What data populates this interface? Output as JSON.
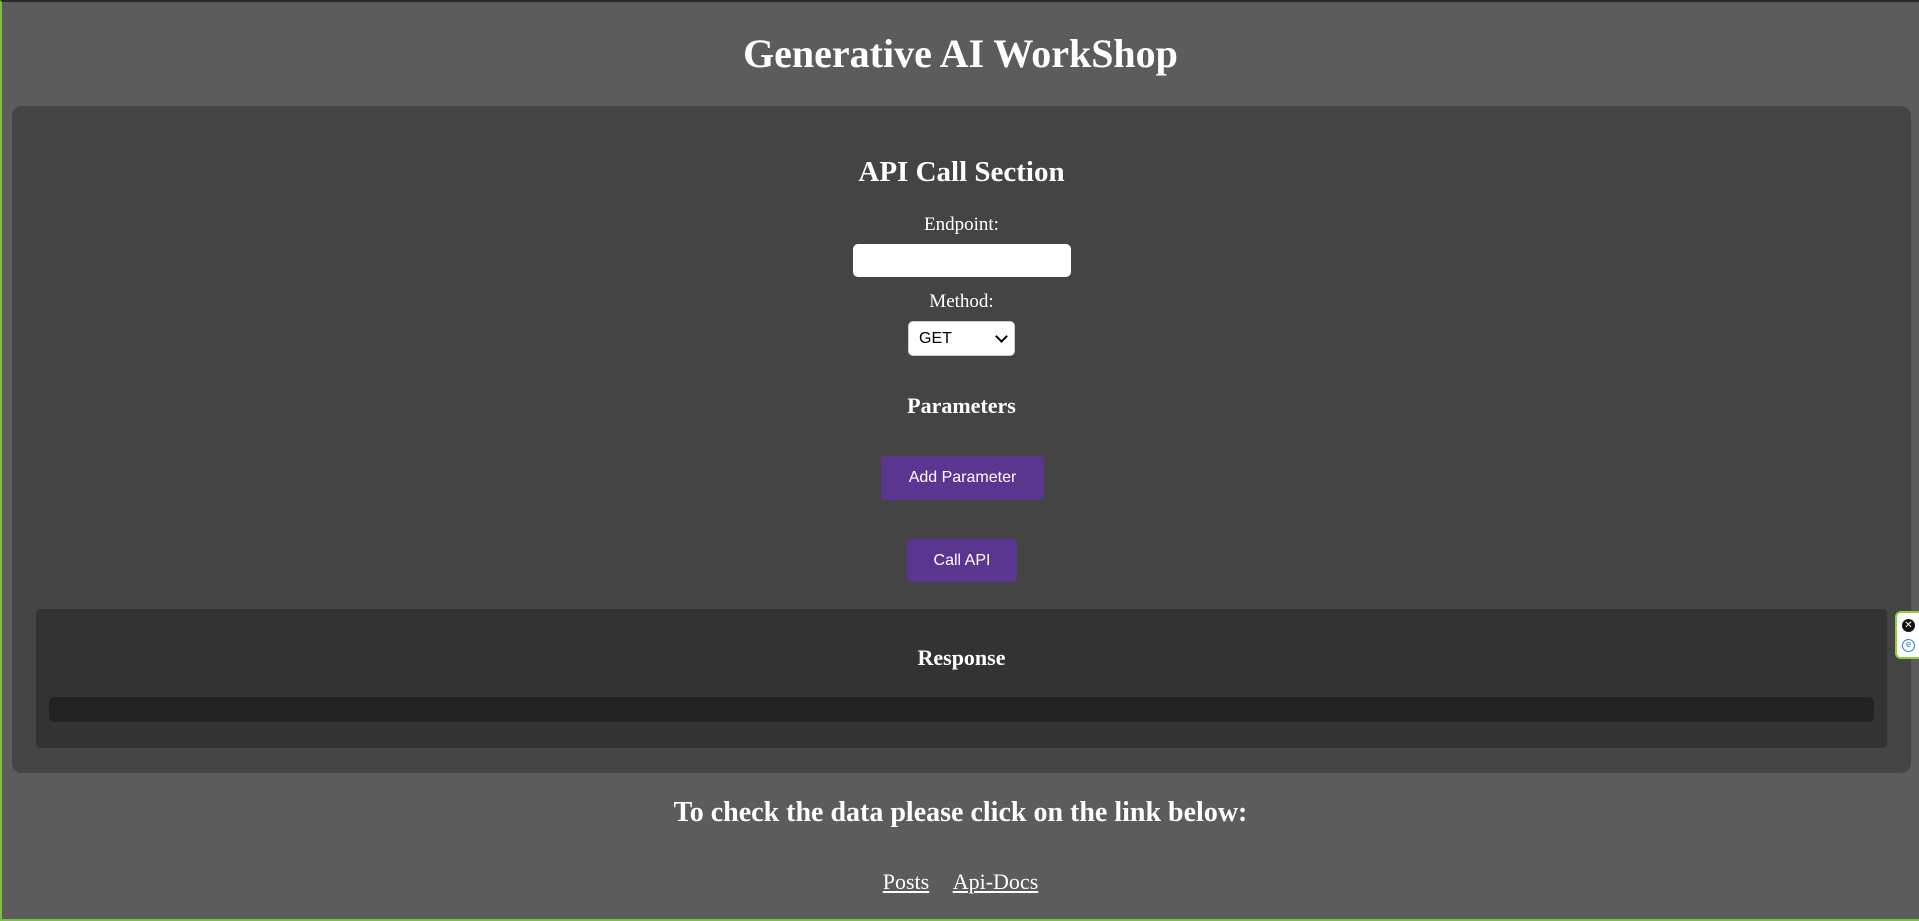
{
  "header": {
    "title": "Generative AI WorkShop"
  },
  "api_section": {
    "title": "API Call Section",
    "endpoint_label": "Endpoint:",
    "endpoint_value": "",
    "method_label": "Method:",
    "method_selected": "GET",
    "parameters_title": "Parameters",
    "add_parameter_label": "Add Parameter",
    "call_api_label": "Call API"
  },
  "response": {
    "title": "Response",
    "output": ""
  },
  "footer": {
    "note": "To check the data please click on the link below:",
    "links": [
      {
        "label": "Posts"
      },
      {
        "label": "Api-Docs"
      }
    ]
  },
  "side_widget": {
    "close_icon": "close-icon",
    "ext_icon": "extension-icon"
  },
  "colors": {
    "page_bg": "#5c5c5c",
    "panel_bg": "#444444",
    "response_bg": "#333333",
    "output_bg": "#222222",
    "button_bg": "#5b3690"
  }
}
